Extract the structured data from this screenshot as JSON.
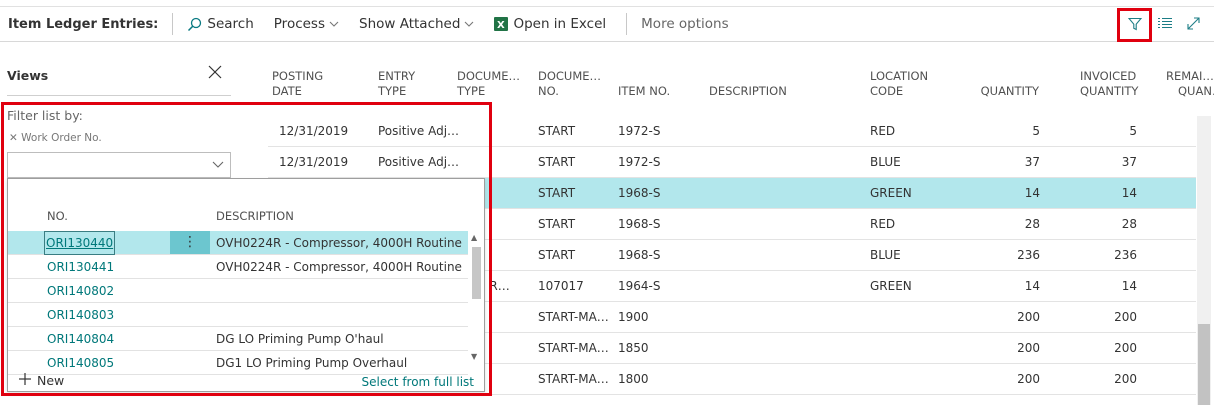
{
  "toolbar": {
    "title": "Item Ledger Entries:",
    "search_label": "Search",
    "process_label": "Process",
    "show_attached_label": "Show Attached",
    "open_excel_label": "Open in Excel",
    "more_options_label": "More options",
    "icons": [
      "search-icon",
      "chevron-down-icon",
      "excel-icon",
      "filter-icon",
      "list-icon",
      "expand-icon"
    ]
  },
  "views": {
    "title": "Views",
    "filter_label": "Filter list by:",
    "filter_chip": "Work Order No.",
    "filter_value": ""
  },
  "grid": {
    "headers": {
      "posting_date": [
        "POSTING",
        "DATE"
      ],
      "entry_type": [
        "ENTRY",
        "TYPE"
      ],
      "document_type": [
        "DOCUME…",
        "TYPE"
      ],
      "document_no": [
        "DOCUME…",
        "NO."
      ],
      "item_no": "ITEM NO.",
      "description": "DESCRIPTION",
      "location_code": [
        "LOCATION",
        "CODE"
      ],
      "quantity": "QUANTITY",
      "invoiced_quantity": [
        "INVOICED",
        "QUANTITY"
      ],
      "remaining": [
        "REMAI…",
        "QUAN…"
      ]
    },
    "rows": [
      {
        "posting_date": "12/31/2019",
        "entry_type": "Positive Adj…",
        "document_type": "",
        "document_no": "START",
        "item_no": "1972-S",
        "location_code": "RED",
        "quantity": "5",
        "invoiced_quantity": "5"
      },
      {
        "posting_date": "12/31/2019",
        "entry_type": "Positive Adj…",
        "document_type": "",
        "document_no": "START",
        "item_no": "1972-S",
        "location_code": "BLUE",
        "quantity": "37",
        "invoiced_quantity": "37"
      },
      {
        "posting_date": "",
        "entry_type": "",
        "document_type": "",
        "document_no": "START",
        "item_no": "1968-S",
        "location_code": "GREEN",
        "quantity": "14",
        "invoiced_quantity": "14"
      },
      {
        "posting_date": "",
        "entry_type": "",
        "document_type": "",
        "document_no": "START",
        "item_no": "1968-S",
        "location_code": "RED",
        "quantity": "28",
        "invoiced_quantity": "28"
      },
      {
        "posting_date": "",
        "entry_type": "",
        "document_type": "",
        "document_no": "START",
        "item_no": "1968-S",
        "location_code": "BLUE",
        "quantity": "236",
        "invoiced_quantity": "236"
      },
      {
        "posting_date": "",
        "entry_type": "",
        "document_type": "hase R…",
        "document_no": "107017",
        "item_no": "1964-S",
        "location_code": "GREEN",
        "quantity": "14",
        "invoiced_quantity": "14"
      },
      {
        "posting_date": "",
        "entry_type": "",
        "document_type": "",
        "document_no": "START-MA…",
        "item_no": "1900",
        "location_code": "",
        "quantity": "200",
        "invoiced_quantity": "200"
      },
      {
        "posting_date": "",
        "entry_type": "",
        "document_type": "",
        "document_no": "START-MA…",
        "item_no": "1850",
        "location_code": "",
        "quantity": "200",
        "invoiced_quantity": "200"
      },
      {
        "posting_date": "",
        "entry_type": "",
        "document_type": "",
        "document_no": "START-MA…",
        "item_no": "1800",
        "location_code": "",
        "quantity": "200",
        "invoiced_quantity": "200"
      }
    ],
    "selected_row": 2
  },
  "lookup": {
    "header_no": "NO.",
    "header_desc": "DESCRIPTION",
    "rows": [
      {
        "no": "ORI130440",
        "desc": "OVH0224R - Compressor, 4000H Routine"
      },
      {
        "no": "ORI130441",
        "desc": "OVH0224R - Compressor, 4000H Routine"
      },
      {
        "no": "ORI140802",
        "desc": ""
      },
      {
        "no": "ORI140803",
        "desc": ""
      },
      {
        "no": "ORI140804",
        "desc": "DG LO Priming Pump O'haul"
      },
      {
        "no": "ORI140805",
        "desc": "DG1 LO Priming Pump Overhaul"
      }
    ],
    "selected_row": 0,
    "actions_glyph": "⋮",
    "new_label": "New",
    "full_list_label": "Select from full list"
  },
  "colors": {
    "accent_teal": "#00787a",
    "selection": "#b2e7ec",
    "highlight_red": "#e0000f",
    "excel_green": "#217346"
  }
}
